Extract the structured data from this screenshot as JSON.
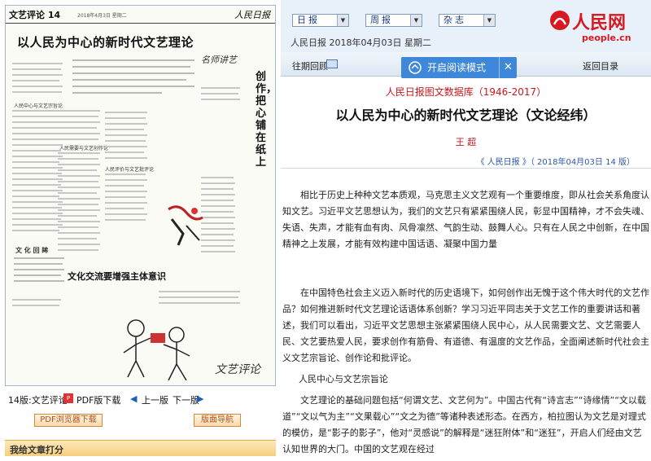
{
  "paper": {
    "section": "文艺评论 14",
    "date": "2018年4月3日 星期二",
    "logo": "人民日报",
    "headline": "以人民为中心的新时代文艺理论",
    "vertical_title": "创作，把心铺在纸上",
    "vertical_title2": "名师讲艺",
    "sub_headline": "文化交流要增强主体意识",
    "corner_mark": "文艺评论",
    "column_heads": [
      "人民中心与文艺宗旨论",
      "人民需要与文艺创作论",
      "人民评价与文艺批评论"
    ],
    "box_title": "文 化 回 眸"
  },
  "page_nav": {
    "page": "14版:文艺评论",
    "pdf": "PDF版下载",
    "prev": "上一版",
    "next": "下一版"
  },
  "buttons": {
    "pdf_browser": "PDF浏览器下载",
    "layout_nav": "版面导航"
  },
  "rating": {
    "label": "我给文章打分"
  },
  "selects": {
    "daily": "日报",
    "weekly": "周报",
    "magazine": "杂志"
  },
  "dateline": "人民日报 2018年04月03日 星期二",
  "logo": {
    "text": "人民网",
    "url": "people.cn"
  },
  "subbar": {
    "history": "往期回顾",
    "read_mode": "开启阅读模式",
    "back": "返回目录"
  },
  "article": {
    "db_title": "人民日报图文数据库（1946-2017）",
    "title": "以人民为中心的新时代文艺理论（文论经纬）",
    "author": "王 超",
    "source": "《 人民日报 》（ 2018年04月03日    14 版）",
    "paragraphs": [
      "相比于历史上种种文艺本质观，马克思主义文艺观有一个重要维度，即从社会关系角度认知文艺。习近平文艺思想认为，我们的文艺只有紧紧围绕人民，彰显中国精神，才不会失魂、失语、失声，才能有血有肉、风骨凛然、气韵生动、鼓舞人心。只有在人民之中创新，在中国精神之上发展，才能有效构建中国话语、凝聚中国力量",
      "在中国特色社会主义迈入新时代的历史语境下，如何创作出无愧于这个伟大时代的文艺作品？如何推进新时代文艺理论话语体系创新？学习习近平同志关于文艺工作的重要讲话和著述，我们可以看出，习近平文艺思想主张紧紧围绕人民中心，从人民需要文艺、文艺需要人民、文艺要热爱人民，要求创作有筋骨、有道德、有温度的文艺作品，全面阐述新时代社会主义文艺宗旨论、创作论和批评论。"
    ],
    "heading": "人民中心与文艺宗旨论",
    "paragraph3": "文艺理论的基础问题包括“何谓文艺、文艺何为”。中国古代有“诗言志”“诗缘情”“文以载道”“文以气为主”“文果载心”“文之为德”等诸种表述形态。在西方，柏拉图认为文艺是对理式的模仿，是“影子的影子”，他对“灵感说”的解释是“迷狂附体”和“迷狂”，开启人们经由文艺认知世界的大门。中国的文艺观在经过"
  }
}
